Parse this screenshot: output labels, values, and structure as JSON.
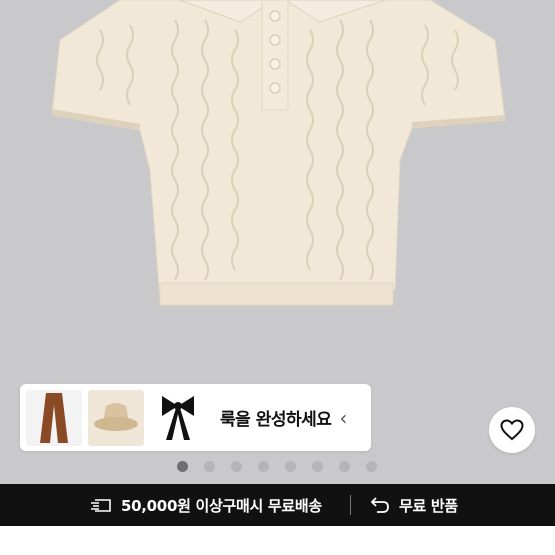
{
  "look": {
    "text": "룩을 완성하세요",
    "chevron": "‹",
    "items": [
      {
        "icon": "brown-pants-icon"
      },
      {
        "icon": "bucket-hat-icon"
      },
      {
        "icon": "black-bow-icon"
      }
    ]
  },
  "wishlist": {
    "icon": "heart-icon"
  },
  "carousel": {
    "count": 8,
    "active_index": 0
  },
  "banner": {
    "shipping": "50,000원 이상구매시 무료배송",
    "returns": "무료 반품",
    "shipping_icon": "truck-icon",
    "returns_icon": "return-arrow-icon"
  },
  "colors": {
    "background": "#c9c9cb",
    "banner": "#111111",
    "sweater": "#f1e8d8"
  }
}
